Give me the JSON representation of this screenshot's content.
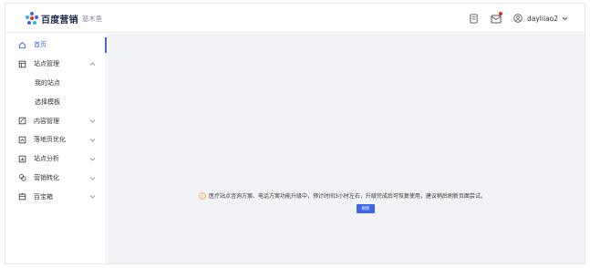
{
  "brand": {
    "name": "百度营销",
    "product": "基木鱼",
    "colors": {
      "primary": "#3d67e8",
      "dot_blue": "#3d67e8",
      "dot_cyan": "#29b6f6",
      "dot_red": "#e62e2e"
    }
  },
  "header": {
    "icons": [
      "document-icon",
      "mail-icon"
    ],
    "user": {
      "icon": "user-circle-icon",
      "name": "dayliiao2"
    }
  },
  "sidebar": {
    "items": [
      {
        "label": "首页",
        "icon": "home-icon",
        "active": true
      },
      {
        "label": "站点管理",
        "icon": "site-icon",
        "expanded": true
      },
      {
        "label": "我的站点",
        "sub": true
      },
      {
        "label": "选择模板",
        "sub": true
      },
      {
        "label": "内容管理",
        "icon": "content-icon"
      },
      {
        "label": "落地页优化",
        "icon": "optimize-icon"
      },
      {
        "label": "站点分析",
        "icon": "analytics-icon"
      },
      {
        "label": "营销转化",
        "icon": "conversion-icon"
      },
      {
        "label": "百宝箱",
        "icon": "toolbox-icon"
      }
    ]
  },
  "main": {
    "notice": "医疗站点咨询方案、电话方案功能升级中，预计时间3小时左右，升级完成后可恢复使用，建议稍后刷新页面尝试。",
    "refresh_label": "刷新"
  }
}
